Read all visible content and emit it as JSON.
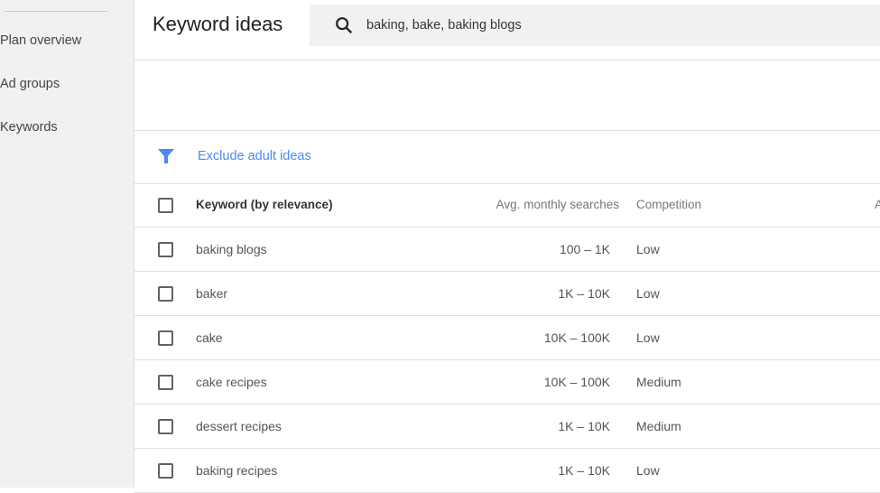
{
  "sidebar": {
    "items": [
      {
        "label": "Plan overview"
      },
      {
        "label": "Ad groups"
      },
      {
        "label": "Keywords"
      }
    ]
  },
  "header": {
    "title": "Keyword ideas",
    "search_value": "baking, bake, baking blogs"
  },
  "filter": {
    "label": "Exclude adult ideas",
    "icon": "filter-icon",
    "color": "#4a8af4"
  },
  "table": {
    "columns": [
      "Keyword (by relevance)",
      "Avg. monthly searches",
      "Competition",
      "A"
    ],
    "rows": [
      {
        "keyword": "baking blogs",
        "searches": "100 – 1K",
        "competition": "Low"
      },
      {
        "keyword": "baker",
        "searches": "1K – 10K",
        "competition": "Low"
      },
      {
        "keyword": "cake",
        "searches": "10K – 100K",
        "competition": "Low"
      },
      {
        "keyword": "cake recipes",
        "searches": "10K – 100K",
        "competition": "Medium"
      },
      {
        "keyword": "dessert recipes",
        "searches": "1K – 10K",
        "competition": "Medium"
      },
      {
        "keyword": "baking recipes",
        "searches": "1K – 10K",
        "competition": "Low"
      }
    ]
  }
}
